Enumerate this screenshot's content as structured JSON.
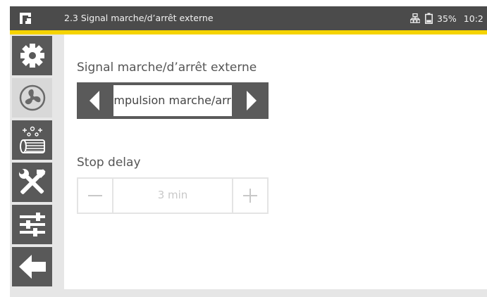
{
  "header": {
    "title": "2.3 Signal marche/d’arrêt externe",
    "battery_percent": "35%",
    "clock": "10:2",
    "icons": [
      "app-logo-icon",
      "network-icon",
      "battery-icon"
    ]
  },
  "sidebar": {
    "items": [
      {
        "name": "settings",
        "icon": "gear-icon",
        "active": true
      },
      {
        "name": "fan",
        "icon": "fan-icon",
        "active": false
      },
      {
        "name": "cleaning",
        "icon": "filter-sparkle-icon",
        "active": true
      },
      {
        "name": "tools",
        "icon": "tools-icon",
        "active": true
      },
      {
        "name": "adjust",
        "icon": "sliders-icon",
        "active": true
      },
      {
        "name": "back",
        "icon": "arrow-left-icon",
        "active": true
      }
    ]
  },
  "main": {
    "signal_label": "Signal marche/d’arrêt externe",
    "signal_value": "Impulsion marche/arr",
    "stop_delay_label": "Stop delay",
    "stop_delay_value": "3 min"
  },
  "colors": {
    "accent": "#f5d300",
    "topbar": "#4b4b4b",
    "button_dark": "#5a5a5a",
    "disabled": "#c8c8c8"
  }
}
